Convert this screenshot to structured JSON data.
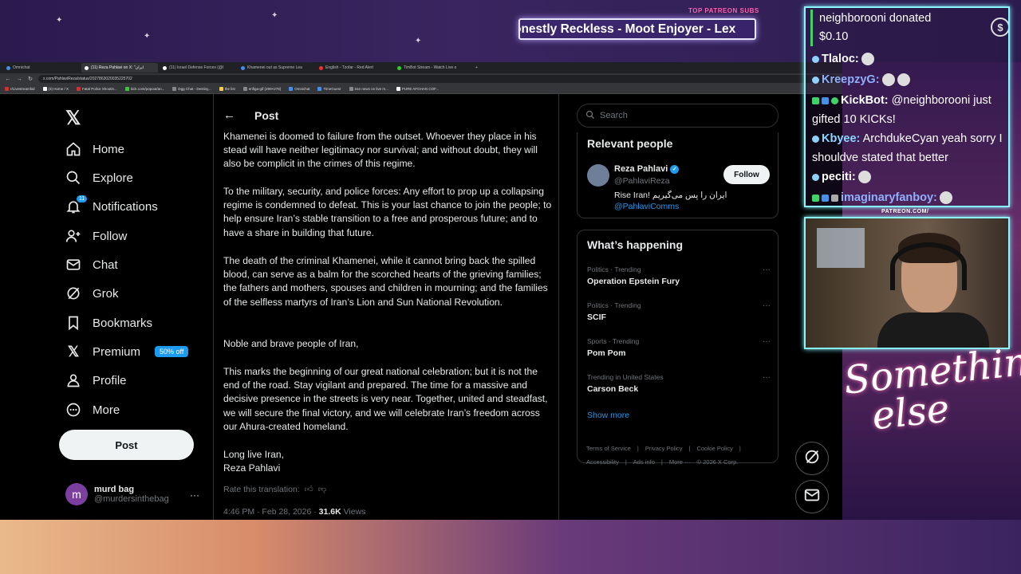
{
  "overlay": {
    "top_subs_label": "TOP PATREON SUBS",
    "ticker_text": "onestly Reckless - Moot Enjoyer - Lex",
    "patreon_label": "PATREON.COM/",
    "script_logo": "Something else"
  },
  "chat": {
    "donation": {
      "user": "neighborooni donated",
      "amount": "$0.10"
    },
    "messages": [
      {
        "name": "Tlaloc:",
        "name_color": "#ffffff",
        "text": ""
      },
      {
        "name": "KreepzyG:",
        "name_color": "#8fb0ff",
        "text": ""
      },
      {
        "name": "KickBot:",
        "name_color": "#ffffff",
        "text": "@neighborooni just gifted 10 KICKs!"
      },
      {
        "name": "Kbyee:",
        "name_color": "#8ad7ff",
        "text": "ArchdukeCyan yeah sorry I shouldve stated that better"
      },
      {
        "name": "peciti:",
        "name_color": "#ffffff",
        "text": ""
      },
      {
        "name": "imaginaryfanboy:",
        "name_color": "#8fb0ff",
        "text": ""
      }
    ]
  },
  "browser": {
    "tabs": [
      {
        "label": "Omnichat",
        "active": false
      },
      {
        "label": "(11) Reza Pahlavi on X: \"ایران",
        "active": true
      },
      {
        "label": "(11) Israel Defense Forces (@I",
        "active": false
      },
      {
        "label": "Khamenei out as Supreme Lea",
        "active": false
      },
      {
        "label": "English - Tzofar - Red Alert",
        "active": false
      },
      {
        "label": "TimBot Stream - Watch Live o",
        "active": false
      }
    ],
    "url": "x.com/PahlaviReza/status/2027863020035225702",
    "bookmarks": [
      "r/Livestreamfail",
      "(3) Home / X",
      "Fatal Police Shootin...",
      "kick.com/popout/an...",
      "Dgg Chat - Destiny...",
      "the list",
      "enfiga-gif (299×278)",
      "Omnichat",
      "TimeGuesr",
      "iran news on live m...",
      "PURE AFGHAN COF..."
    ]
  },
  "nav": {
    "items": [
      {
        "label": "Home",
        "icon": "home-icon"
      },
      {
        "label": "Explore",
        "icon": "search-icon"
      },
      {
        "label": "Notifications",
        "icon": "bell-icon",
        "badge": "11"
      },
      {
        "label": "Follow",
        "icon": "follow-icon"
      },
      {
        "label": "Chat",
        "icon": "mail-icon"
      },
      {
        "label": "Grok",
        "icon": "grok-icon"
      },
      {
        "label": "Bookmarks",
        "icon": "bookmark-icon"
      },
      {
        "label": "Premium",
        "icon": "x-icon",
        "pill": "50% off"
      },
      {
        "label": "Profile",
        "icon": "person-icon"
      },
      {
        "label": "More",
        "icon": "more-icon"
      }
    ],
    "post_button": "Post",
    "account": {
      "avatar_letter": "m",
      "name": "murd bag",
      "handle": "@murdersinthebag"
    }
  },
  "post": {
    "header": "Post",
    "paragraphs": [
      "Khamenei is doomed to failure from the outset. Whoever they place in his stead will have neither legitimacy nor survival; and without doubt, they will also be complicit in the crimes of this regime.",
      "To the military, security, and police forces: Any effort to prop up a collapsing regime is condemned to defeat. This is your last chance to join the people; to help ensure Iran’s stable transition to a free and prosperous future; and to have a share in building that future.",
      "The death of the criminal Khamenei, while it cannot bring back the spilled blood, can serve as a balm for the scorched hearts of the grieving families; the fathers and mothers, spouses and children in mourning; and the families of the selfless martyrs of Iran’s Lion and Sun National Revolution.",
      "Noble and brave people of Iran,",
      "This marks the beginning of our great national celebration; but it is not the end of the road. Stay vigilant and prepared. The time for a massive and decisive presence in the streets is very near. Together, united and steadfast, we will secure the final victory, and we will celebrate Iran’s freedom across our Ahura-created homeland.",
      "Long live Iran,\nReza Pahlavi"
    ],
    "rate_translation": "Rate this translation:",
    "time": "4:46 PM · Feb 28, 2026 · ",
    "views_count": "31.6K",
    "views_label": " Views"
  },
  "sidebar": {
    "search_placeholder": "Search",
    "relevant_title": "Relevant people",
    "person": {
      "name": "Reza Pahlavi",
      "handle": "@PahlaviReza",
      "bio": "Rise Iran! ایران را پس می‌گیریم",
      "bio_link": "@PahlaviComms",
      "follow": "Follow"
    },
    "happening_title": "What’s happening",
    "trends": [
      {
        "category": "Politics · Trending",
        "name": "Operation Epstein Fury"
      },
      {
        "category": "Politics · Trending",
        "name": "SCIF"
      },
      {
        "category": "Sports · Trending",
        "name": "Pom Pom"
      },
      {
        "category": "Trending in United States",
        "name": "Carson Beck"
      }
    ],
    "show_more": "Show more",
    "footer_line1": [
      "Terms of Service",
      "|",
      "Privacy Policy",
      "|",
      "Cookie Policy",
      "|"
    ],
    "footer_line2": [
      "Accessibility",
      "|",
      "Ads info",
      "|",
      "More ···",
      "© 2026 X Corp."
    ]
  }
}
